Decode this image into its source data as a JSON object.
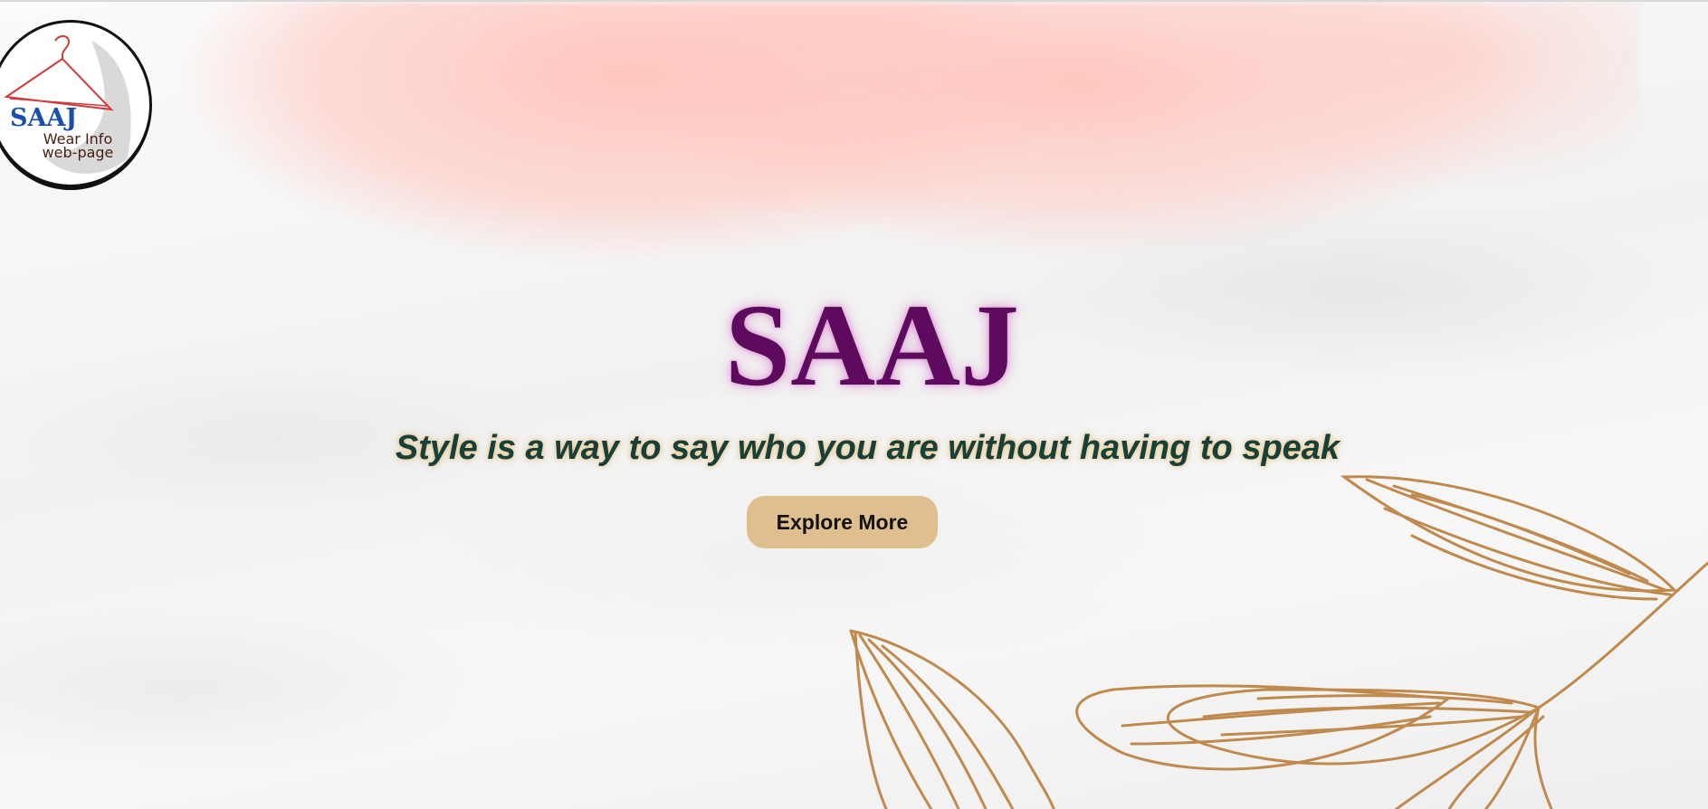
{
  "logo": {
    "title": "SAAJ",
    "subtitle_line1": "Wear Info",
    "subtitle_line2": "web-page",
    "icon": "hanger-icon"
  },
  "hero": {
    "title": "SAAJ",
    "tagline": "Style is a way to say who you are without having to speak",
    "cta_label": "Explore More"
  },
  "colors": {
    "title": "#5e0a5e",
    "tagline": "#17403a",
    "button": "#dfbf8d",
    "leaf": "#c08a4e",
    "pink_wash": "#ffc4bc",
    "logo_title": "#1a4fb0"
  },
  "decoration": {
    "leaves": "leaf-branch-illustration"
  }
}
